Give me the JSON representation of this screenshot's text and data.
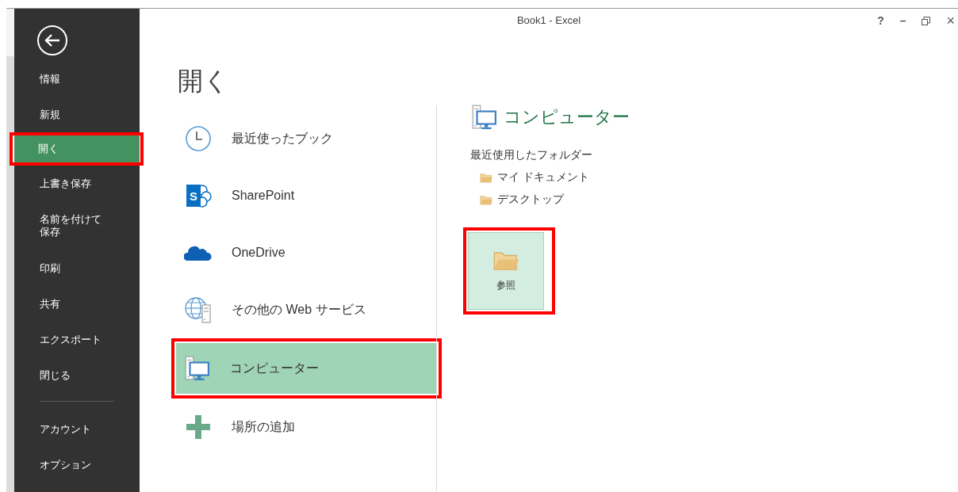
{
  "window": {
    "title": "Book1 - Excel",
    "help": "?",
    "minimize": "–",
    "close": "×"
  },
  "sidebar": {
    "items": [
      {
        "label": "情報",
        "selected": false,
        "highlighted": false
      },
      {
        "label": "新規",
        "selected": false,
        "highlighted": false
      },
      {
        "label": "開く",
        "selected": true,
        "highlighted": true
      },
      {
        "label": "上書き保存",
        "selected": false,
        "highlighted": false
      },
      {
        "label": "名前を付けて保存",
        "selected": false,
        "highlighted": false
      },
      {
        "label": "印刷",
        "selected": false,
        "highlighted": false
      },
      {
        "label": "共有",
        "selected": false,
        "highlighted": false
      },
      {
        "label": "エクスポート",
        "selected": false,
        "highlighted": false
      },
      {
        "label": "閉じる",
        "selected": false,
        "highlighted": false
      }
    ],
    "footer_items": [
      {
        "label": "アカウント",
        "selected": false,
        "highlighted": false
      },
      {
        "label": "オプション",
        "selected": false,
        "highlighted": false
      }
    ]
  },
  "page_title": "開く",
  "places": [
    {
      "label": "最近使ったブック",
      "kind": "clock",
      "selected": false,
      "highlighted": false
    },
    {
      "label": "SharePoint",
      "kind": "sharepoint",
      "icon_text": "S",
      "selected": false,
      "highlighted": false
    },
    {
      "label": "OneDrive",
      "kind": "onedrive",
      "selected": false,
      "highlighted": false
    },
    {
      "label": "その他の Web サービス",
      "kind": "web",
      "selected": false,
      "highlighted": false
    },
    {
      "label": "コンピューター",
      "kind": "computer",
      "selected": true,
      "highlighted": true
    },
    {
      "label": "場所の追加",
      "kind": "add",
      "selected": false,
      "highlighted": false
    }
  ],
  "detail": {
    "title": "コンピューター",
    "section_label": "最近使用したフォルダー",
    "folders": [
      "マイ ドキュメント",
      "デスクトップ"
    ],
    "browse": {
      "label": "参照",
      "highlighted": true
    }
  }
}
